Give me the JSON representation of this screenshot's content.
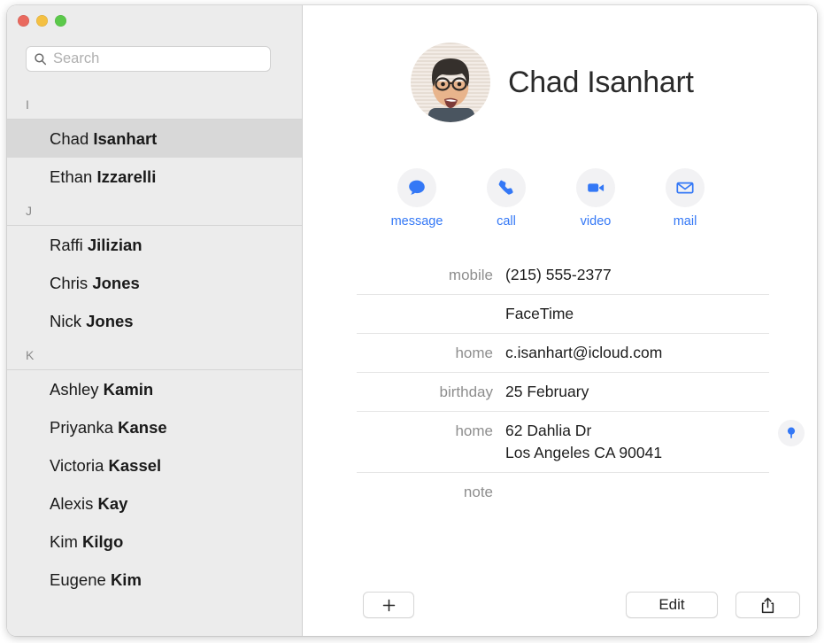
{
  "window": {
    "traffic_lights": [
      {
        "name": "close",
        "color": "#e9695e"
      },
      {
        "name": "minimize",
        "color": "#f4c042"
      },
      {
        "name": "zoom",
        "color": "#5bc94a"
      }
    ]
  },
  "search": {
    "placeholder": "Search",
    "value": "",
    "icon": "search-icon"
  },
  "sidebar": {
    "sections": [
      {
        "letter": "I",
        "contacts": [
          {
            "first": "Chad ",
            "last": "Isanhart",
            "selected": true
          },
          {
            "first": "Ethan ",
            "last": "Izzarelli",
            "selected": false
          }
        ]
      },
      {
        "letter": "J",
        "contacts": [
          {
            "first": "Raffi ",
            "last": "Jilizian",
            "selected": false
          },
          {
            "first": "Chris ",
            "last": "Jones",
            "selected": false
          },
          {
            "first": "Nick ",
            "last": "Jones",
            "selected": false
          }
        ]
      },
      {
        "letter": "K",
        "contacts": [
          {
            "first": "Ashley ",
            "last": "Kamin",
            "selected": false
          },
          {
            "first": "Priyanka ",
            "last": "Kanse",
            "selected": false
          },
          {
            "first": "Victoria ",
            "last": "Kassel",
            "selected": false
          },
          {
            "first": "Alexis ",
            "last": "Kay",
            "selected": false
          },
          {
            "first": "Kim ",
            "last": "Kilgo",
            "selected": false
          },
          {
            "first": "Eugene ",
            "last": "Kim",
            "selected": false
          }
        ]
      }
    ]
  },
  "detail": {
    "name": "Chad Isanhart",
    "avatar": "contact-photo",
    "actions": [
      {
        "label": "message",
        "icon": "message-bubble-icon"
      },
      {
        "label": "call",
        "icon": "phone-icon"
      },
      {
        "label": "video",
        "icon": "video-camera-icon"
      },
      {
        "label": "mail",
        "icon": "envelope-icon"
      }
    ],
    "fields": [
      {
        "label": "mobile",
        "value": "(215) 555-2377"
      },
      {
        "label": "",
        "value": "FaceTime"
      },
      {
        "label": "home",
        "value": "c.isanhart@icloud.com"
      },
      {
        "label": "birthday",
        "value": "25 February"
      },
      {
        "label": "home",
        "value": "62 Dahlia Dr\nLos Angeles CA 90041",
        "map_pin": true
      },
      {
        "label": "note",
        "value": ""
      }
    ],
    "map_pin_icon": "map-pin-icon"
  },
  "toolbar": {
    "add_label": "+",
    "edit_label": "Edit",
    "share_icon": "share-icon"
  },
  "colors": {
    "accent_blue": "#3478f6",
    "sidebar_bg": "#ececec",
    "selection_bg": "#d8d8d8",
    "label_gray": "#8e8e8e"
  }
}
